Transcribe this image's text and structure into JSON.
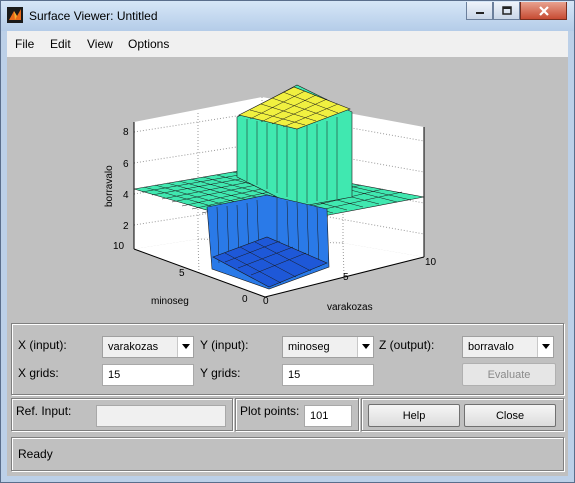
{
  "window": {
    "title": "Surface Viewer: Untitled"
  },
  "menu": [
    "File",
    "Edit",
    "View",
    "Options"
  ],
  "plot": {
    "z_label": "borravalo",
    "y_label": "minoseg",
    "x_label": "varakozas",
    "z_ticks": [
      "8",
      "6",
      "4",
      "2"
    ],
    "y_ticks": [
      "10",
      "5",
      "0"
    ],
    "x_ticks": [
      "0",
      "5",
      "10"
    ]
  },
  "controls": {
    "x_input_label": "X (input):",
    "x_input_value": "varakozas",
    "y_input_label": "Y (input):",
    "y_input_value": "minoseg",
    "z_output_label": "Z (output):",
    "z_output_value": "borravalo",
    "x_grids_label": "X grids:",
    "x_grids_value": "15",
    "y_grids_label": "Y grids:",
    "y_grids_value": "15",
    "evaluate_label": "Evaluate",
    "ref_input_label": "Ref. Input:",
    "ref_input_value": "",
    "plot_points_label": "Plot points:",
    "plot_points_value": "101",
    "help_label": "Help",
    "close_label": "Close",
    "status": "Ready"
  },
  "colors": {
    "surface_high": "#f0f040",
    "surface_mid": "#40e8b0",
    "surface_low": "#2a7ae8",
    "surface_lowest": "#1e58d8"
  }
}
